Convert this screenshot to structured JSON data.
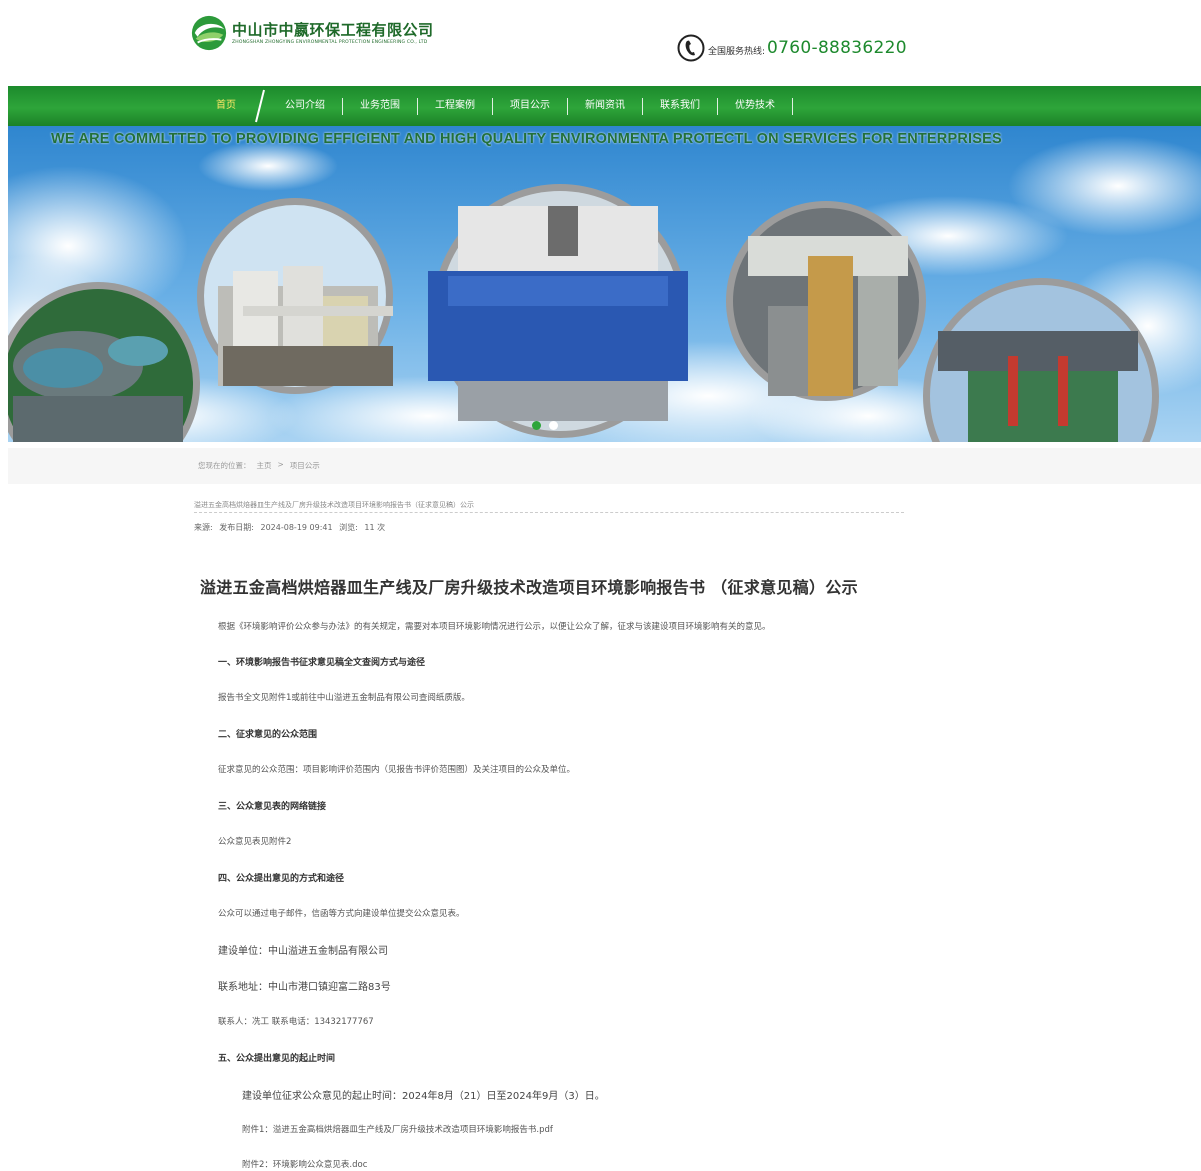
{
  "header": {
    "company_name": "中山市中嬴环保工程有限公司",
    "company_name_en": "ZHONGSHAN ZHONGYING ENVIRONMENTAL PROTECTION ENGINEERING CO., LTD",
    "hotline_label": "全国服务热线:",
    "hotline_number": "0760-88836220"
  },
  "nav": {
    "items": [
      {
        "label": "首页",
        "active": true
      },
      {
        "label": "公司介绍"
      },
      {
        "label": "业务范围"
      },
      {
        "label": "工程案例"
      },
      {
        "label": "项目公示"
      },
      {
        "label": "新闻资讯"
      },
      {
        "label": "联系我们"
      },
      {
        "label": "优势技术"
      }
    ]
  },
  "banner": {
    "slogan": "WE ARE COMMLTTED TO PROVIDING EFFICIENT AND HIGH QUALITY ENVIRONMENTA PROTECTL ON SERVICES FOR ENTERPRISES",
    "dots": [
      {
        "active": true
      },
      {
        "active": false
      }
    ]
  },
  "breadcrumb": {
    "prefix": "您现在的位置：",
    "home": "主页",
    "separator": ">",
    "current": "项目公示"
  },
  "article": {
    "short_title": "溢进五金高档烘焙器皿生产线及厂房升级技术改造项目环境影响报告书（征求意见稿）公示",
    "source_label": "来源:",
    "date_label": "发布日期:",
    "date": "2024-08-19 09:41",
    "views_label": "浏览:",
    "views": "11 次",
    "title": "溢进五金高档烘焙器皿生产线及厂房升级技术改造项目环境影响报告书 （征求意见稿）公示",
    "intro": "根据《环境影响评价公众参与办法》的有关规定，需要对本项目环境影响情况进行公示，以便让公众了解，征求与该建设项目环境影响有关的意见。",
    "s1_heading": "一、环境影响报告书征求意见稿全文查阅方式与途径",
    "s1_text": "报告书全文见附件1或前往中山溢进五金制品有限公司查阅纸质版。",
    "s2_heading": "二、征求意见的公众范围",
    "s2_text": "征求意见的公众范围：项目影响评价范围内（见报告书评价范围图）及关注项目的公众及单位。",
    "s3_heading": "三、公众意见表的网络链接",
    "s3_text": "公众意见表见附件2",
    "s4_heading": "四、公众提出意见的方式和途径",
    "s4_text": "公众可以通过电子邮件，信函等方式向建设单位提交公众意见表。",
    "builder": "建设单位：中山溢进五金制品有限公司",
    "address": "联系地址：中山市港口镇迎富二路83号",
    "contact": "联系人：冼工   联系电话：13432177767",
    "s5_heading": "五、公众提出意见的起止时间",
    "s5_text": "建设单位征求公众意见的起止时间：2024年8月（21）日至2024年9月（3）日。",
    "attachment1": "附件1：溢进五金高档烘焙器皿生产线及厂房升级技术改造项目环境影响报告书.pdf",
    "attachment2": "附件2：环境影响公众意见表.doc"
  },
  "colors": {
    "brand_green": "#1e8a2e",
    "nav_active": "#ffe866",
    "sky": "#4a98d8"
  }
}
